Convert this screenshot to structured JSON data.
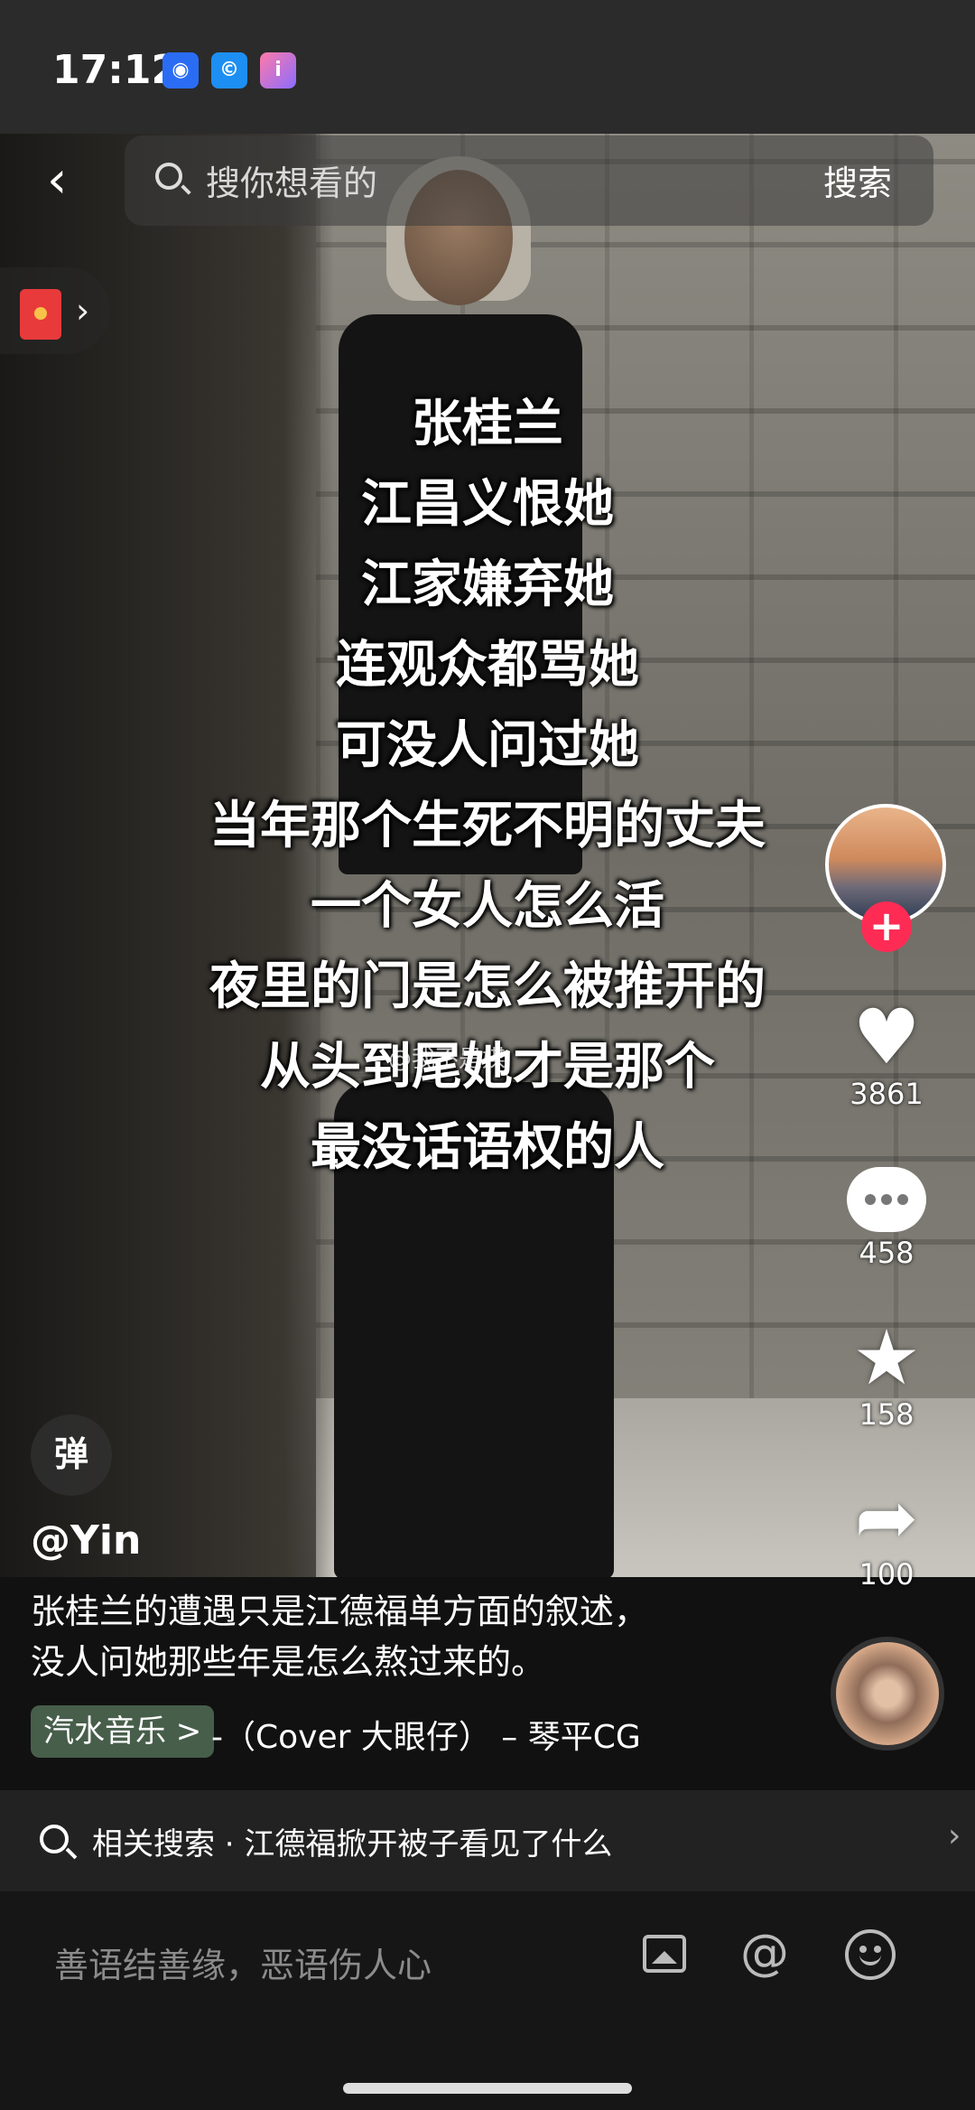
{
  "status_bar": {
    "time": "17:12"
  },
  "search": {
    "placeholder": "搜你想看的",
    "button": "搜索"
  },
  "overlay_text": [
    "张桂兰",
    "江昌义恨她",
    "江家嫌弃她",
    "连观众都骂她",
    "可没人问过她",
    "当年那个生死不明的丈夫",
    "一个女人怎么活",
    "夜里的门是怎么被推开的",
    "从头到尾她才是那个",
    "最没话语权的人"
  ],
  "watermark": "@我不是媒",
  "actions": {
    "likes": "3861",
    "comments": "458",
    "favorites": "158",
    "shares": "100"
  },
  "danmu_label": "弹",
  "author": "@Yin",
  "description": [
    "张桂兰的遭遇只是江德福单方面的叙述，",
    "没人问她那些年是怎么熬过来的。"
  ],
  "music": {
    "tag": "汽水音乐 >",
    "title": "-（Cover 大眼仔） – 琴平CG"
  },
  "related_search": "相关搜索 · 江德福掀开被子看见了什么",
  "comment_input": {
    "placeholder": "善语结善缘，恶语伤人心"
  },
  "icons": {
    "back": "chevron-left",
    "search": "search",
    "red_packet": "red-envelope",
    "like": "heart",
    "comment": "chat-bubble",
    "favorite": "star",
    "share": "share-arrow",
    "image": "image",
    "mention": "at-sign",
    "emoji": "smiley"
  }
}
